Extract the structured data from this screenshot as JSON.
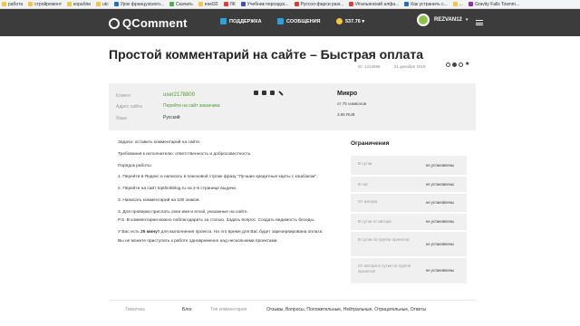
{
  "bookmarks": [
    {
      "label": "работа",
      "color": "#f4c542"
    },
    {
      "label": "стройремонт",
      "color": "#f4c542"
    },
    {
      "label": "корабли",
      "color": "#f4c542"
    },
    {
      "label": "utc",
      "color": "#f4c542"
    },
    {
      "label": "Урок французского...",
      "color": "#1e73be"
    },
    {
      "label": "Скачать",
      "color": "#4caf50"
    },
    {
      "label": "esel32",
      "color": "#f4c542"
    },
    {
      "label": "ЛК",
      "color": "#e53935"
    },
    {
      "label": "Учебник персидск...",
      "color": "#3f51b5"
    },
    {
      "label": "Руссоо-фарси разг...",
      "color": "#e53935"
    },
    {
      "label": "Итальянский алфа...",
      "color": "#e53935"
    },
    {
      "label": "Как устранить с...",
      "color": "#1e73be"
    },
    {
      "label": "...",
      "color": "#f4c542"
    },
    {
      "label": "Gravity Falls Townm...",
      "color": "#9c27b0"
    }
  ],
  "header": {
    "logo": "QComment",
    "support": "ПОДДЕРЖКА",
    "messages": "СООБЩЕНИЯ",
    "balance": "537.76 ▾",
    "username": "REZVAN12"
  },
  "task": {
    "title": "Простой комментарий на сайте – Быстрая оплата",
    "id": "ID: 1412666",
    "date": "21 декабря 2019"
  },
  "info": {
    "client_label": "Клиент",
    "client_value": "user2178800",
    "site_label": "Адрес сайта",
    "site_value": "Перейти на сайт заказчика",
    "lang_label": "Язык",
    "lang_value": "Русский",
    "type": "Микро",
    "chars": "от 75 символов",
    "price": "3.65 RUB"
  },
  "description": {
    "p1": "Задача: оставить комментарий на сайте.",
    "p2": "Требования к исполнителю: ответственность и добросовестность.",
    "p3": "Порядок работы:",
    "s1": "1. Перейти в Яндекс и написать в поисковой строке фразу \"Лучшие кредитные карты с кэшбэком\".",
    "s2": "2. Перейти на сайт topthinkblog.ru на 2-5 странице выдачи.",
    "s3": "3. Написать комментарий на 100 знаков.",
    "s4": "3. Для проверки прислать свои имя и email, указанные на сайте.",
    "ps": "P.S. В комментарии можно поблагодарить за статью. Задать вопрос. Создать видимость беседы.",
    "time_a": "У Вас есть ",
    "time_b": "25 минут",
    "time_c": " для выполнения проекта. На это время для Вас будет зарезервирована оплата.",
    "time_d": "Вы не можете приступать к работе одновременно над несколькими проектами."
  },
  "restrictions": {
    "title": "Ограничения",
    "rows": [
      {
        "label": "В сутки",
        "value": "не установлены"
      },
      {
        "label": "В час",
        "value": "не установлены"
      },
      {
        "label": "От автора",
        "value": "не установлены"
      },
      {
        "label": "В сутки от автора",
        "value": "не установлены"
      },
      {
        "label": "В сутки по группе проектов",
        "value": "не установлены"
      },
      {
        "label": "От автора в сутки по группе проектов",
        "value": "не установлены"
      }
    ]
  },
  "footer": {
    "theme_label": "Тематика",
    "theme_value": "Блог",
    "type_label": "Тип комментария",
    "type_value": "Отзывы, Вопросы, Положительные, Нейтральные, Отрицательные, Ответы"
  }
}
